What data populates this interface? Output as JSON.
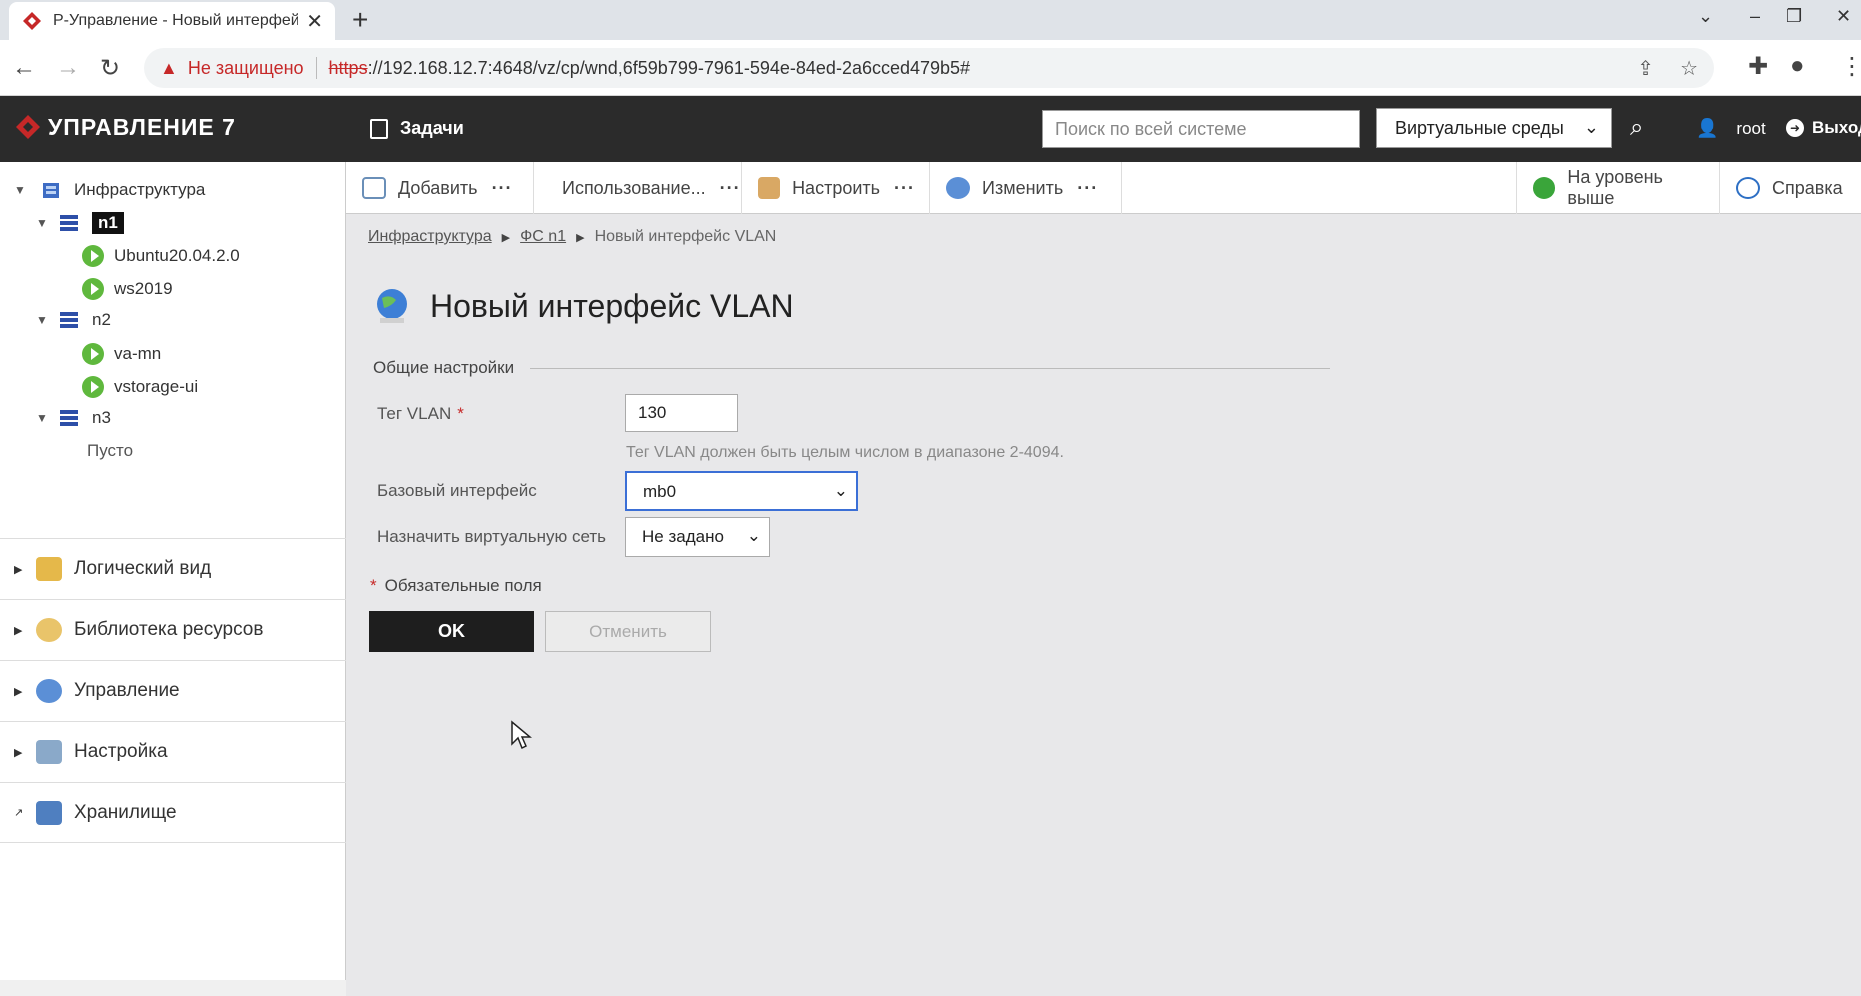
{
  "browser": {
    "tab_title": "Р-Управление - Новый интерфейс VLAN",
    "tab_close": "✕",
    "new_tab": "+",
    "security_label": "Не защищено",
    "url_scheme": "https",
    "url_rest": "://192.168.12.7:4648/vz/cp/wnd,6f59b799-7961-594e-84ed-2a6cced479b5#"
  },
  "app": {
    "logo_text": "УПРАВЛЕНИЕ 7",
    "tasks_label": "Задачи",
    "search_placeholder": "Поиск по всей системе",
    "env_select": "Виртуальные среды",
    "user": "root",
    "logout": "Выход"
  },
  "sidebar": {
    "root_label": "Инфраструктура",
    "nodes": [
      {
        "label": "n1",
        "vms": [
          "Ubuntu20.04.2.0",
          "ws2019"
        ]
      },
      {
        "label": "n2",
        "vms": [
          "va-mn",
          "vstorage-ui"
        ]
      },
      {
        "label": "n3",
        "empty": "Пусто"
      }
    ],
    "sections": [
      "Логический вид",
      "Библиотека ресурсов",
      "Управление",
      "Настройка",
      "Хранилище"
    ]
  },
  "toolbar": {
    "add": "Добавить",
    "usage": "Использование...",
    "configure": "Настроить",
    "change": "Изменить",
    "more": "···",
    "up_level": "На уровень выше",
    "help": "Справка"
  },
  "breadcrumb": {
    "items": [
      "Инфраструктура",
      "ФС n1",
      "Новый интерфейс VLAN"
    ]
  },
  "page": {
    "title": "Новый интерфейс VLAN",
    "section_legend": "Общие настройки",
    "vlan_tag_label": "Тег VLAN",
    "vlan_tag_value": "130",
    "vlan_hint": "Тег VLAN должен быть целым числом в диапазоне 2-4094.",
    "base_iface_label": "Базовый интерфейс",
    "base_iface_value": "mb0",
    "vnet_label": "Назначить виртуальную сеть",
    "vnet_value": "Не задано",
    "required_note": "Обязательные поля",
    "required_mark": "*",
    "ok_label": "OK",
    "cancel_label": "Отменить"
  },
  "colors": {
    "header_bg": "#2b2b2b",
    "accent_red": "#c62828",
    "vm_running": "#5fb83d",
    "node_blue": "#2d4fa8"
  }
}
